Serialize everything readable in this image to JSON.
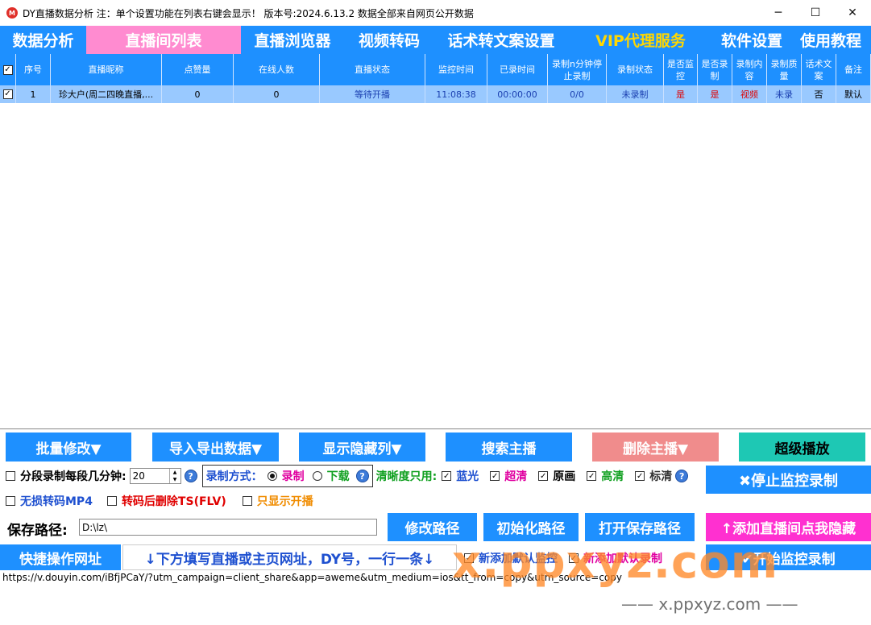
{
  "window": {
    "logo_text": "M",
    "title": "DY直播数据分析   注：单个设置功能在列表右键会显示！   版本号:2024.6.13.2   数据全部来自网页公开数据",
    "min": "─",
    "max": "☐",
    "close": "✕"
  },
  "nav": [
    "数据分析",
    "直播间列表",
    "直播浏览器",
    "视频转码",
    "话术转文案设置",
    "VIP代理服务",
    "软件设置",
    "使用教程"
  ],
  "table": {
    "headers": [
      "序号",
      "直播昵称",
      "点赞量",
      "在线人数",
      "直播状态",
      "监控时间",
      "已录时间",
      "录制n分钟停止录制",
      "录制状态",
      "是否监控",
      "是否录制",
      "录制内容",
      "录制质量",
      "话术文案",
      "备注"
    ],
    "rows": [
      [
        "1",
        "珍大户(周二四晚直播,...",
        "0",
        "0",
        "等待开播",
        "11:08:38",
        "00:00:00",
        "0/0",
        "未录制",
        "是",
        "是",
        "视频",
        "未录",
        "否",
        "默认"
      ]
    ],
    "check": "✓"
  },
  "buttons": {
    "batch_edit": "批量修改▼",
    "import_export": "导入导出数据▼",
    "show_hidden": "显示隐藏列▼",
    "search": "搜索主播",
    "delete": "删除主播▼",
    "super_play": "超级播放",
    "stop_monitor": "✖停止监控录制",
    "modify_path": "修改路径",
    "init_path": "初始化路径",
    "open_path": "打开保存路径",
    "add_room": "↑添加直播间点我隐藏",
    "start": "✔开始监控录制",
    "quick_url": "快捷操作网址"
  },
  "options": {
    "segment_label": "分段录制每段几分钟:",
    "segment_value": "20",
    "record_mode_label": "录制方式：",
    "record": "录制",
    "download": "下载",
    "clarity_label": "清晰度只用:",
    "bluray": "蓝光",
    "super_hd": "超清",
    "original": "原画",
    "hd": "高清",
    "sd": "标清",
    "lossless": "无损转码MP4",
    "delete_ts": "转码后删除TS(FLV)",
    "show_live_only": "只显示开播",
    "add_default_monitor": "新添加默认监控",
    "add_default_record": "新添加默认录制"
  },
  "save_path": {
    "label": "保存路径:",
    "value": "D:\\lz\\"
  },
  "hint": "↓下方填写直播或主页网址，DY号，一行一条↓",
  "url_text": "https://v.douyin.com/iBfjPCaY/?utm_campaign=client_share&app=aweme&utm_medium=ios&tt_from=copy&utm_source=copy",
  "watermark": {
    "big": "x.ppxyz.com",
    "small": "—— x.ppxyz.com ——"
  },
  "colors": {
    "accent": "#1e90ff",
    "active_tab": "#ff8bd0",
    "vip": "#ffd700"
  }
}
